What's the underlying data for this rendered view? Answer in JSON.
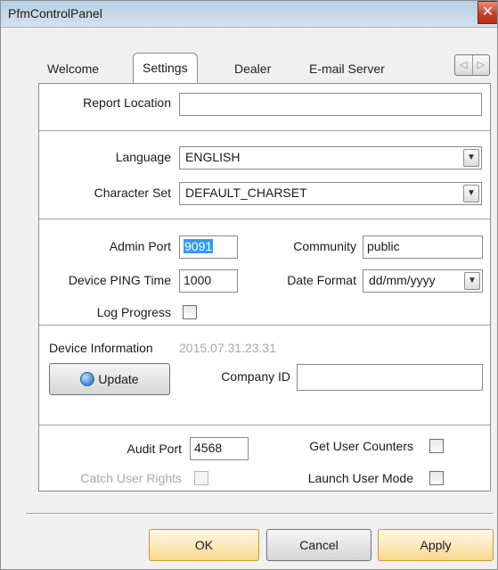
{
  "window": {
    "title": "PfmControlPanel",
    "close_glyph": "✕"
  },
  "tabs": [
    {
      "label": "Welcome"
    },
    {
      "label": "Settings"
    },
    {
      "label": "Dealer"
    },
    {
      "label": "E-mail Server"
    }
  ],
  "tab_scroll": {
    "left": "◁",
    "right": "▷"
  },
  "settings": {
    "report_location": {
      "label": "Report Location",
      "value": ""
    },
    "language": {
      "label": "Language",
      "value": "ENGLISH"
    },
    "character_set": {
      "label": "Character Set",
      "value": "DEFAULT_CHARSET"
    },
    "admin_port": {
      "label": "Admin Port",
      "value": "9091"
    },
    "community": {
      "label": "Community",
      "value": "public"
    },
    "device_ping_time": {
      "label": "Device PING Time",
      "value": "1000"
    },
    "date_format": {
      "label": "Date Format",
      "value": "dd/mm/yyyy"
    },
    "log_progress": {
      "label": "Log Progress",
      "checked": false
    },
    "device_information": {
      "label": "Device Information",
      "value": "2015.07.31.23.31"
    },
    "update_button": {
      "label": "Update",
      "icon": "update-icon"
    },
    "company_id": {
      "label": "Company ID",
      "value": ""
    },
    "audit_port": {
      "label": "Audit Port",
      "value": "4568"
    },
    "get_user_counters": {
      "label": "Get User Counters",
      "checked": false
    },
    "catch_user_rights": {
      "label": "Catch User Rights",
      "checked": false,
      "disabled": true
    },
    "launch_user_mode": {
      "label": "Launch User Mode",
      "checked": false
    }
  },
  "footer": {
    "ok": "OK",
    "cancel": "Cancel",
    "apply": "Apply"
  },
  "dropdown_glyph": "▼",
  "colors": {
    "selection": "#3399ff",
    "default_button": "#f7d88c",
    "close_button": "#c7432b"
  }
}
